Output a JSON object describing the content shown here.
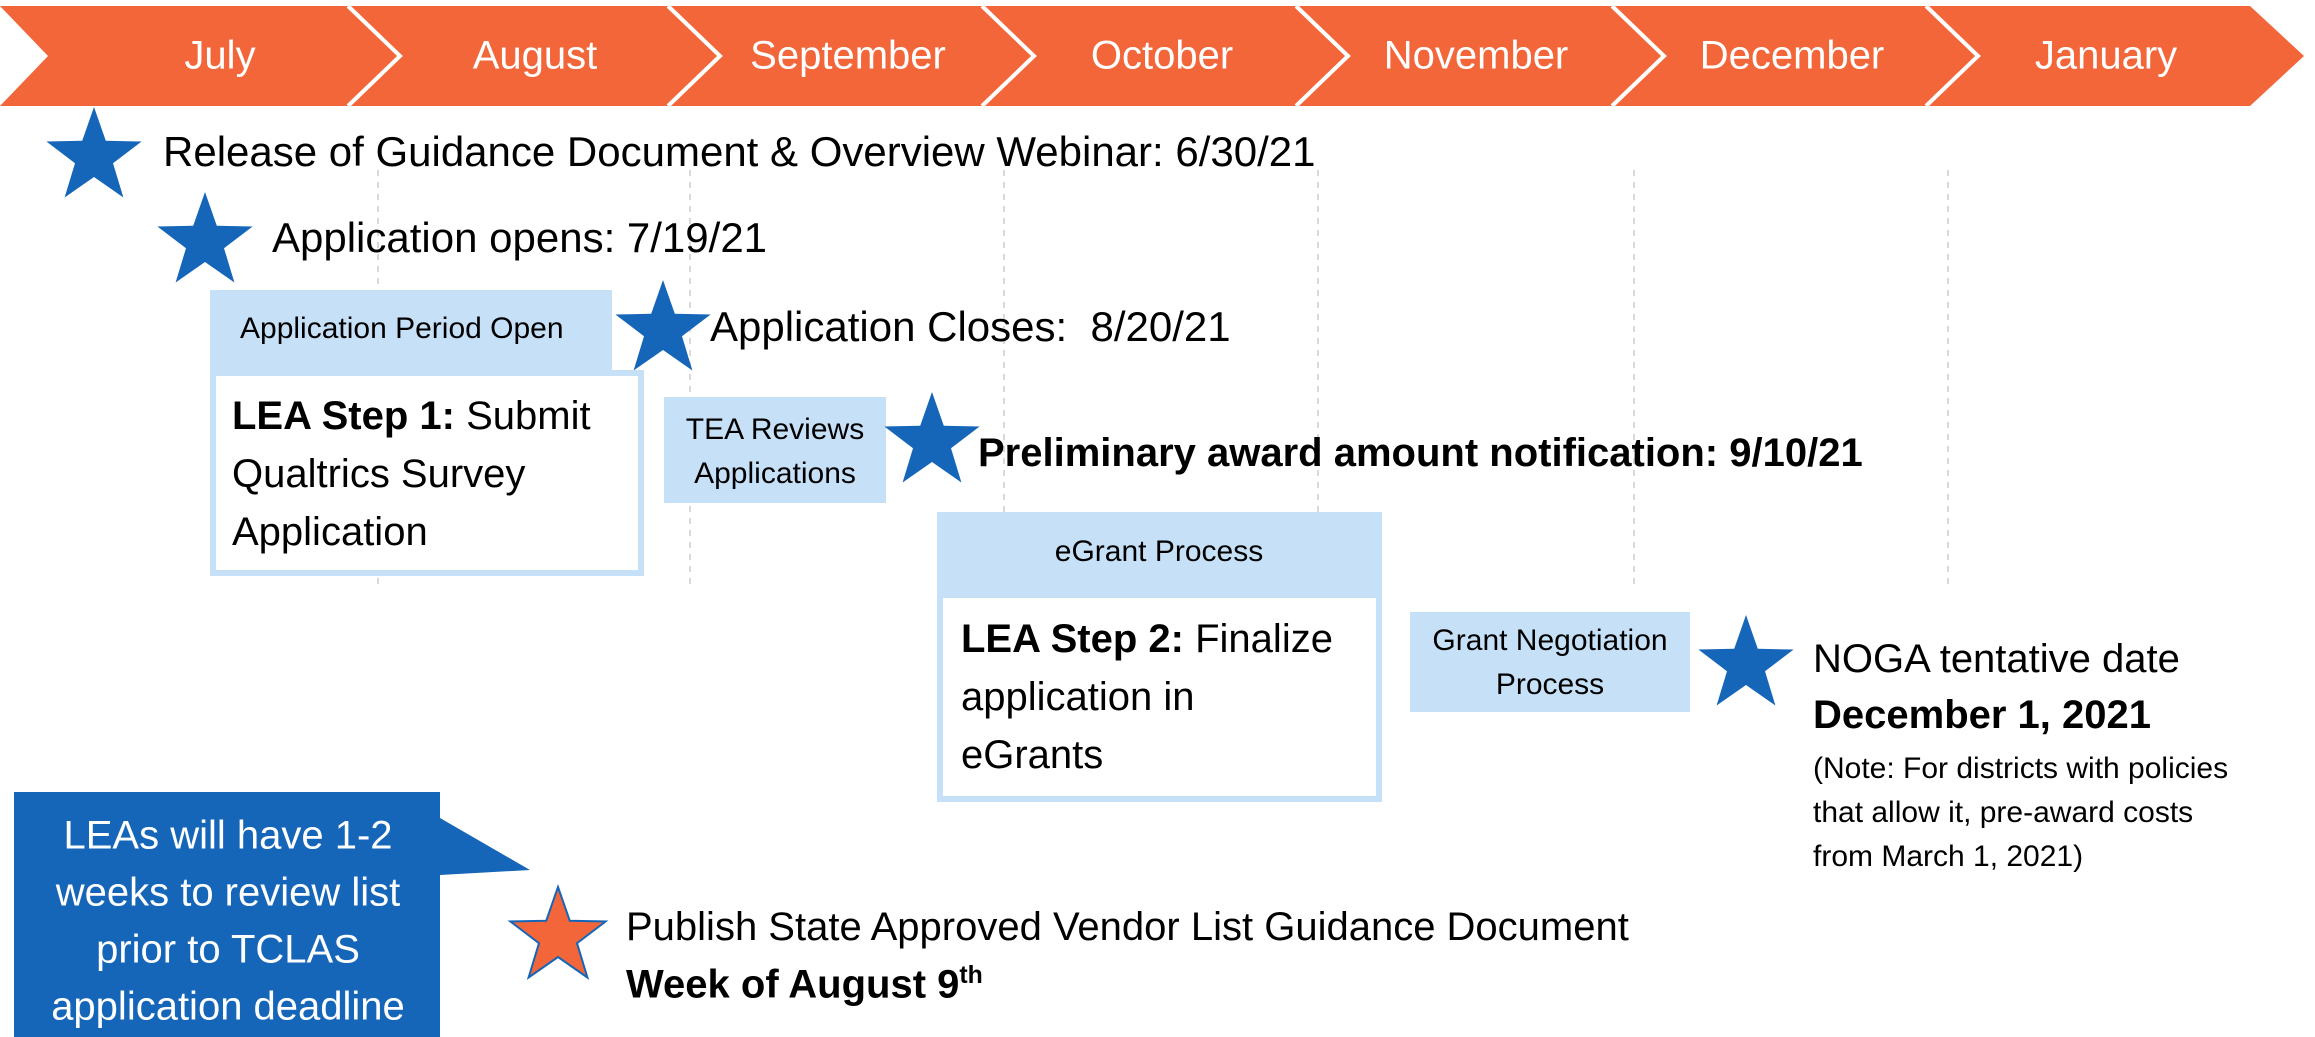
{
  "colors": {
    "banner": "#f2663a",
    "star_blue": "#1565b9",
    "star_orange": "#f2663a",
    "light_blue": "#c6e1f7",
    "callout_bg": "#1565b9",
    "gridline": "#d9d9d9"
  },
  "months": [
    "July",
    "August",
    "September",
    "October",
    "November",
    "December",
    "January"
  ],
  "milestones": {
    "release": {
      "icon": "star-icon",
      "text": "Release of Guidance Document & Overview Webinar: 6/30/21"
    },
    "app_opens": {
      "icon": "star-icon",
      "text": "Application opens: 7/19/21"
    },
    "app_closes": {
      "icon": "star-icon",
      "text": "Application Closes:  8/20/21"
    },
    "preliminary": {
      "icon": "star-icon",
      "text": "Preliminary award amount notification: 9/10/21"
    },
    "noga": {
      "icon": "star-icon",
      "line1": "NOGA tentative date",
      "line2": "December 1, 2021",
      "note_lines": [
        "(Note: For districts with policies",
        "that allow it, pre-award costs",
        "from March 1, 2021)"
      ]
    },
    "vendor": {
      "icon": "star-icon",
      "line1": "Publish State Approved Vendor List Guidance Document",
      "line2": "Week of August 9",
      "sup": "th"
    }
  },
  "phases": {
    "application_period": "Application Period Open",
    "tea_reviews": [
      "TEA Reviews",
      "Applications"
    ],
    "egrant": "eGrant Process",
    "grant_negotiation": [
      "Grant Negotiation",
      "Process"
    ]
  },
  "steps": {
    "step1": {
      "bold": "LEA Step 1:",
      "rest": " Submit",
      "lines": [
        "Qualtrics Survey",
        "Application"
      ]
    },
    "step2": {
      "bold": "LEA Step 2:",
      "rest": " Finalize",
      "lines": [
        "application in",
        "eGrants"
      ]
    }
  },
  "callout": {
    "lines": [
      "LEAs will have 1-2",
      "weeks to review list",
      "prior to TCLAS",
      "application deadline"
    ]
  }
}
